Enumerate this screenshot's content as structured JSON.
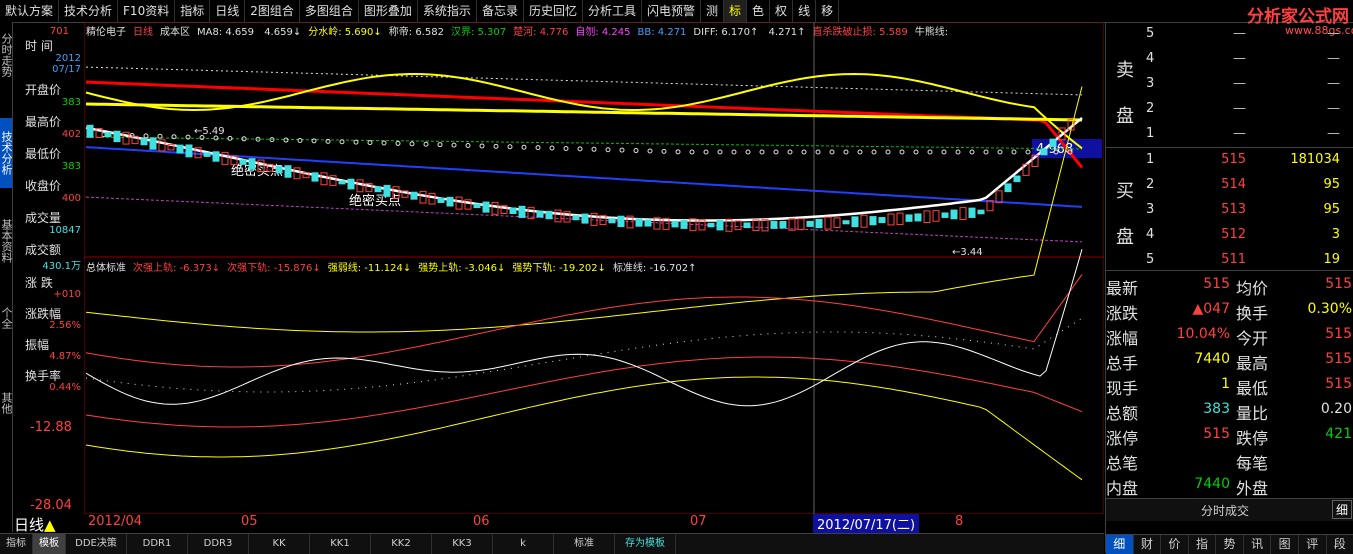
{
  "toolbar": {
    "items": [
      "默认方案",
      "技术分析",
      "F10资料",
      "指标",
      "日线",
      "2图组合",
      "多图组合",
      "图形叠加",
      "系统指示",
      "备忘录",
      "历史回忆",
      "分析工具",
      "闪电预警",
      "测",
      "标",
      "色",
      "权",
      "线",
      "移"
    ],
    "active": "标"
  },
  "logo": {
    "name": "分析家公式网",
    "url": "www.88gs.com"
  },
  "left_tabs": [
    "分时走势",
    "技术分析",
    "基本资料",
    "个全",
    "其他"
  ],
  "left_panel": {
    "top_value": "701",
    "time_label": "时 间",
    "date_year": "2012",
    "date_md": "07/17",
    "open_label": "开盘价",
    "open_value": "383",
    "high_label": "最高价",
    "high_value": "402",
    "low_label": "最低价",
    "low_value": "383",
    "close_label": "收盘价",
    "close_value": "400",
    "volume_label": "成交量",
    "volume_value": "10847",
    "amount_label": "成交额",
    "amount_value": "430.1万",
    "change_label": "涨 跌",
    "change_value": "+010",
    "change_pct_label": "涨跌幅",
    "change_pct_value": "2.56%",
    "amplitude_label": "振幅",
    "amplitude_value": "4.87%",
    "turnover_label": "换手率",
    "turnover_value": "0.44%"
  },
  "main_indicator": {
    "stock": "精伦电子",
    "period": "日线",
    "name": "成本区",
    "items": [
      {
        "label": "MA8:",
        "value": "4.659",
        "color": "#e0e0e0"
      },
      {
        "label": "",
        "value": "4.659",
        "color": "#e0e0e0",
        "arrow": "↓"
      },
      {
        "label": "分水岭:",
        "value": "5.690",
        "color": "#ffff00",
        "arrow": "↓"
      },
      {
        "label": "称帝:",
        "value": "6.582",
        "color": "#e0e0e0"
      },
      {
        "label": "汉界:",
        "value": "5.307",
        "color": "#00d000"
      },
      {
        "label": "楚河:",
        "value": "4.776",
        "color": "#ff4040"
      },
      {
        "label": "自刎:",
        "value": "4.245",
        "color": "#ff40ff"
      },
      {
        "label": "BB:",
        "value": "4.271",
        "color": "#40a0ff"
      },
      {
        "label": "DIFF:",
        "value": "6.170",
        "color": "#e0e0e0",
        "arrow": "↑"
      },
      {
        "label": "",
        "value": "4.271",
        "color": "#e0e0e0",
        "arrow": "↑"
      },
      {
        "label": "直杀跌破止损:",
        "value": "5.589",
        "color": "#ff4040"
      },
      {
        "label": "牛熊线:",
        "value": "",
        "color": "#e0e0e0"
      }
    ]
  },
  "price_tag": "4.968",
  "annotations": {
    "buy_point": "绝密买点",
    "high_mark": "5.49",
    "low_mark": "3.44"
  },
  "sub_indicator": {
    "name": "总体标准",
    "items": [
      {
        "label": "次强上轨:",
        "value": "-6.373",
        "color": "#ff4040",
        "arrow": "↓"
      },
      {
        "label": "次强下轨:",
        "value": "-15.876",
        "color": "#ff4040",
        "arrow": "↓"
      },
      {
        "label": "强弱线:",
        "value": "-11.124",
        "color": "#ffff00",
        "arrow": "↓"
      },
      {
        "label": "强势上轨:",
        "value": "-3.046",
        "color": "#ffff00",
        "arrow": "↓"
      },
      {
        "label": "强势下轨:",
        "value": "-19.202",
        "color": "#ffff00",
        "arrow": "↓"
      },
      {
        "label": "标准线:",
        "value": "-16.702",
        "color": "#e0e0e0",
        "arrow": "↑"
      }
    ],
    "axis_labels": [
      "-12.88",
      "-28.04"
    ]
  },
  "date_axis": {
    "labels": [
      "2012/04",
      "05",
      "06",
      "07",
      "8"
    ],
    "cursor_date": "2012/07/17(二)"
  },
  "period_label": "日线",
  "bottom_tabs": [
    "指标",
    "模板",
    "DDE决策",
    "DDR1",
    "DDR3",
    "KK",
    "KK1",
    "KK2",
    "KK3",
    "k",
    "标准",
    "存为模板"
  ],
  "bottom_active": "模板",
  "order_book": {
    "sell_label": [
      "卖",
      "盘"
    ],
    "buy_label": [
      "买",
      "盘"
    ],
    "sells": [
      {
        "level": "5",
        "price": "—",
        "volume": "—"
      },
      {
        "level": "4",
        "price": "—",
        "volume": "—"
      },
      {
        "level": "3",
        "price": "—",
        "volume": "—"
      },
      {
        "level": "2",
        "price": "—",
        "volume": "—"
      },
      {
        "level": "1",
        "price": "—",
        "volume": "—"
      }
    ],
    "buys": [
      {
        "level": "1",
        "price": "515",
        "volume": "181034"
      },
      {
        "level": "2",
        "price": "514",
        "volume": "95"
      },
      {
        "level": "3",
        "price": "513",
        "volume": "95"
      },
      {
        "level": "4",
        "price": "512",
        "volume": "3"
      },
      {
        "level": "5",
        "price": "511",
        "volume": "19"
      }
    ]
  },
  "quote": [
    {
      "l1": "最新",
      "v1": "515",
      "c1": "#ff4040",
      "l2": "均价",
      "v2": "515",
      "c2": "#ff4040"
    },
    {
      "l1": "涨跌",
      "v1": "▲047",
      "c1": "#ff4040",
      "l2": "换手",
      "v2": "0.30%",
      "c2": "#ffff00"
    },
    {
      "l1": "涨幅",
      "v1": "10.04%",
      "c1": "#ff4040",
      "l2": "今开",
      "v2": "515",
      "c2": "#ff4040"
    },
    {
      "l1": "总手",
      "v1": "7440",
      "c1": "#ffff00",
      "l2": "最高",
      "v2": "515",
      "c2": "#ff4040"
    },
    {
      "l1": "现手",
      "v1": "1",
      "c1": "#ffff00",
      "l2": "最低",
      "v2": "515",
      "c2": "#ff4040"
    },
    {
      "l1": "总额",
      "v1": "383",
      "c1": "#40e0e0",
      "l2": "量比",
      "v2": "0.20",
      "c2": "#e0e0e0"
    },
    {
      "l1": "涨停",
      "v1": "515",
      "c1": "#ff4040",
      "l2": "跌停",
      "v2": "421",
      "c2": "#00d000"
    },
    {
      "l1": "总笔",
      "v1": "",
      "c1": "#e0e0e0",
      "l2": "每笔",
      "v2": "",
      "c2": "#e0e0e0"
    },
    {
      "l1": "内盘",
      "v1": "7440",
      "c1": "#00d000",
      "l2": "外盘",
      "v2": "",
      "c2": "#ff4040"
    }
  ],
  "tick_header": "分时成交",
  "tick_button": "细",
  "right_tabs": [
    "细",
    "财",
    "价",
    "指",
    "势",
    "讯",
    "图",
    "评",
    "段"
  ],
  "right_active": "细",
  "colors": {
    "red": "#ff4040",
    "green": "#00d000",
    "yellow": "#ffff00",
    "blue": "#40a0ff",
    "cyan": "#40e0e0"
  }
}
